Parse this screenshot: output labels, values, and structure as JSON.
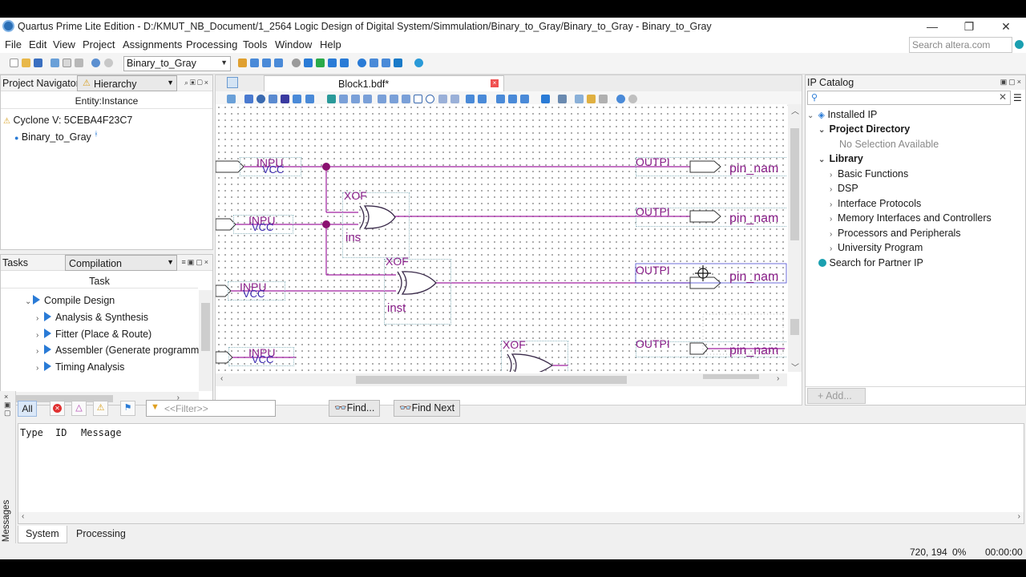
{
  "window": {
    "title": "Quartus Prime Lite Edition - D:/KMUT_NB_Document/1_2564 Logic Design of Digital System/Simmulation/Binary_to_Gray/Binary_to_Gray - Binary_to_Gray",
    "minimize": "—",
    "restore": "❐",
    "close": "✕"
  },
  "menu": [
    "File",
    "Edit",
    "View",
    "Project",
    "Assignments",
    "Processing",
    "Tools",
    "Window",
    "Help"
  ],
  "search": {
    "placeholder": "Search altera.com"
  },
  "toolbar": {
    "entity": "Binary_to_Gray"
  },
  "project_navigator": {
    "label": "Project Navigator",
    "view": "Hierarchy",
    "column": "Entity:Instance",
    "device": "Cyclone V: 5CEBA4F23C7",
    "top_entity": "Binary_to_Gray"
  },
  "tasks": {
    "label": "Tasks",
    "flow": "Compilation",
    "column": "Task",
    "items": [
      "Compile Design",
      "Analysis & Synthesis",
      "Fitter (Place & Route)",
      "Assembler (Generate programm",
      "Timing Analysis"
    ]
  },
  "editor": {
    "tab": "Block1.bdf*",
    "schematic": {
      "inputs": [
        "INPU",
        "INPU",
        "INPU",
        "INPU"
      ],
      "vcc": [
        "VCC",
        "VCC",
        "VCC",
        "VCC"
      ],
      "outputs": [
        "OUTPI",
        "OUTPI",
        "OUTPI",
        "OUTPI"
      ],
      "pin_names": [
        "pin_nam",
        "pin_nam",
        "pin_nam",
        "pin_nam"
      ],
      "gates": [
        "XOF",
        "XOF",
        "XOF"
      ],
      "instances": [
        "ins",
        "inst"
      ]
    }
  },
  "ip_catalog": {
    "title": "IP Catalog",
    "installed": "Installed IP",
    "project_dir": "Project Directory",
    "no_selection": "No Selection Available",
    "library": "Library",
    "library_items": [
      "Basic Functions",
      "DSP",
      "Interface Protocols",
      "Memory Interfaces and Controllers",
      "Processors and Peripherals",
      "University Program"
    ],
    "partner": "Search for Partner IP",
    "add": "+ Add..."
  },
  "messages": {
    "side_label": "Messages",
    "all": "All",
    "filter_placeholder": "<<Filter>>",
    "find": "Find...",
    "find_next": "Find Next",
    "columns": [
      "Type",
      "ID",
      "Message"
    ],
    "tabs": [
      "System",
      "Processing"
    ]
  },
  "status": {
    "coords": "720, 194",
    "zoom": "0%",
    "time": "00:00:00"
  },
  "colors": {
    "net": "#a020a0",
    "junction": "#8a1070",
    "accent": "#2a7bd6",
    "gate": "#6a2a7a"
  }
}
